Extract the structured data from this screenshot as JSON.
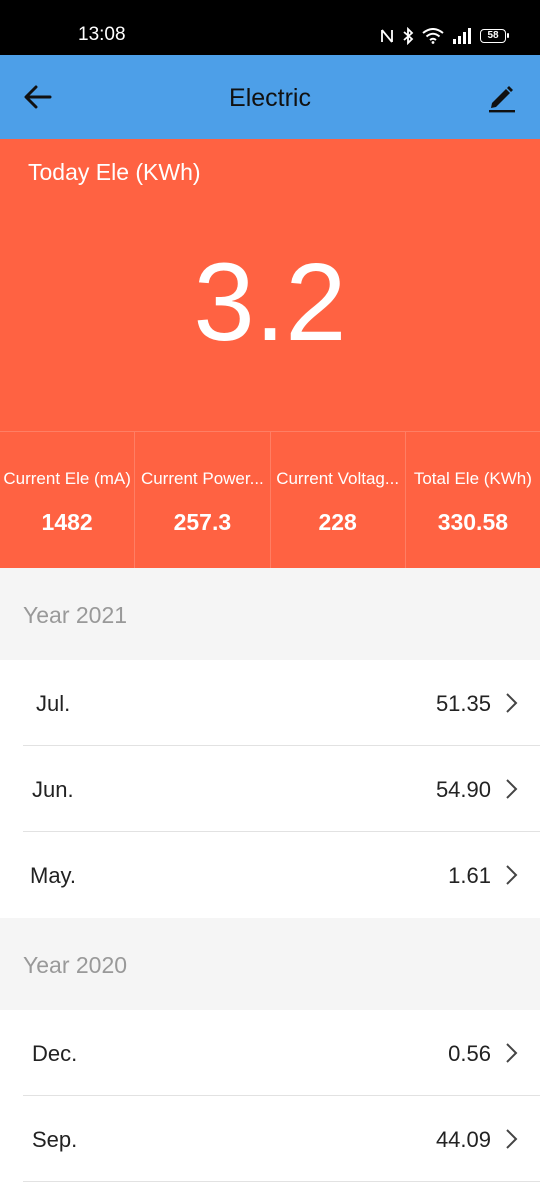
{
  "status_bar": {
    "time": "13:08",
    "battery": "58",
    "icons": [
      "nfc-icon",
      "bluetooth-icon",
      "wifi-icon",
      "signal-icon",
      "battery-icon"
    ]
  },
  "app_bar": {
    "title": "Electric",
    "back_icon": "arrow-left-icon",
    "edit_icon": "pencil-icon",
    "color": "#4d9fe8"
  },
  "hero": {
    "label": "Today Ele (KWh)",
    "value": "3.2",
    "color": "#ff6242"
  },
  "stats": [
    {
      "label": "Current Ele (mA)",
      "value": "1482"
    },
    {
      "label": "Current Power...",
      "value": "257.3"
    },
    {
      "label": "Current Voltag...",
      "value": "228"
    },
    {
      "label": "Total Ele (KWh)",
      "value": "330.58"
    }
  ],
  "sections": [
    {
      "header": "Year 2021",
      "months": [
        {
          "label": "Jul.",
          "value": "51.35"
        },
        {
          "label": "Jun.",
          "value": "54.90"
        },
        {
          "label": "May.",
          "value": "1.61"
        }
      ]
    },
    {
      "header": "Year 2020",
      "months": [
        {
          "label": "Dec.",
          "value": "0.56"
        },
        {
          "label": "Sep.",
          "value": "44.09"
        }
      ]
    }
  ]
}
